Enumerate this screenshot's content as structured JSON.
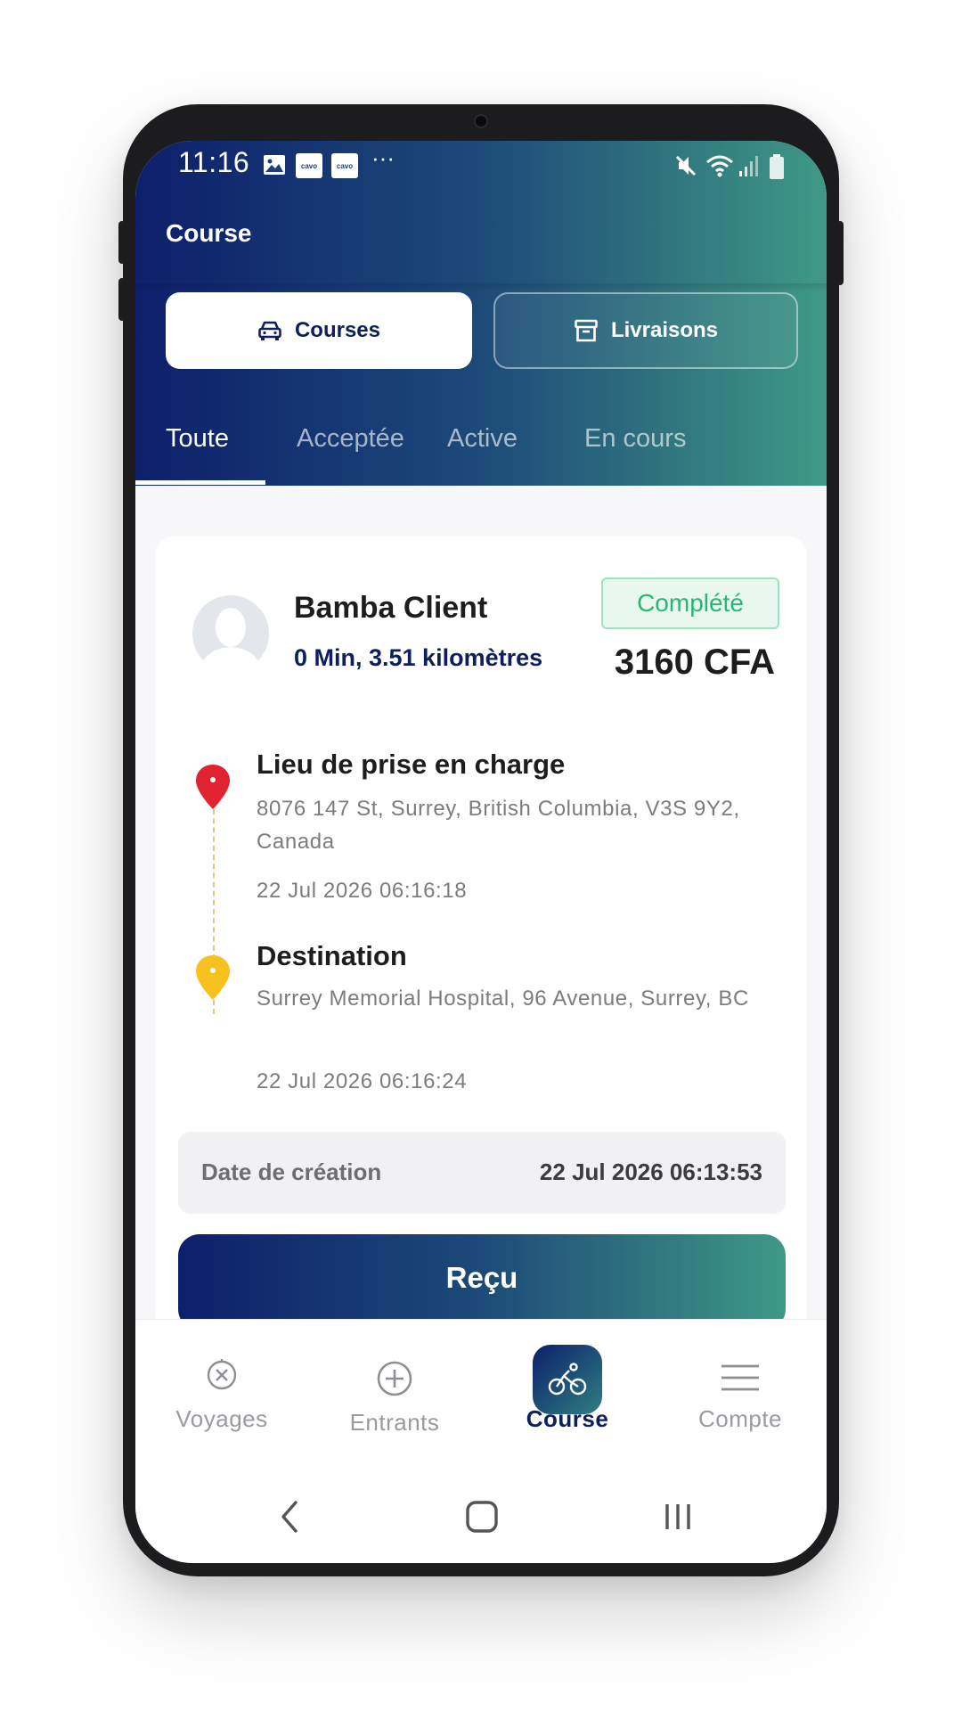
{
  "status_bar": {
    "time": "11:16",
    "notification_icons": [
      "image-icon",
      "cavo-app-icon",
      "cavo-app-icon",
      "more-icon"
    ],
    "app_badge_text": "cavo",
    "more_text": "···",
    "system_icons": [
      "mute-icon",
      "wifi-icon",
      "signal-icon",
      "battery-icon"
    ]
  },
  "header": {
    "title": "Course",
    "segments": [
      {
        "label": "Courses",
        "icon": "car-icon",
        "selected": true
      },
      {
        "label": "Livraisons",
        "icon": "archive-box-icon",
        "selected": false
      }
    ],
    "tabs": [
      {
        "label": "Toute",
        "active": true
      },
      {
        "label": "Acceptée",
        "active": false
      },
      {
        "label": "Active",
        "active": false
      },
      {
        "label": "En cours",
        "active": false
      }
    ]
  },
  "ride": {
    "client_name": "Bamba Client",
    "meta": "0 Min, 3.51 kilomètres",
    "status": "Complété",
    "price": "3160 CFA",
    "pickup": {
      "title": "Lieu de prise en charge",
      "address": "8076 147 St, Surrey, British Columbia, V3S 9Y2, Canada",
      "time": "22 Jul 2026 06:16:18"
    },
    "destination": {
      "title": "Destination",
      "address": "Surrey Memorial Hospital, 96 Avenue, Surrey, BC",
      "time": "22 Jul 2026 06:16:24"
    },
    "creation_label": "Date de création",
    "creation_value": "22 Jul 2026 06:13:53",
    "receipt_button": "Reçu"
  },
  "bottom_nav": [
    {
      "label": "Voyages",
      "icon": "compass-icon",
      "active": false
    },
    {
      "label": "Entrants",
      "icon": "plus-circle-icon",
      "active": false
    },
    {
      "label": "Course",
      "icon": "bicycle-icon",
      "active": true
    },
    {
      "label": "Compte",
      "icon": "menu-icon",
      "active": false
    }
  ],
  "colors": {
    "brand_dark": "#0d1f6b",
    "brand_teal": "#3f9985",
    "status_green": "#2bb673",
    "pickup_pin": "#e0242f",
    "destination_pin": "#f7c21e"
  }
}
